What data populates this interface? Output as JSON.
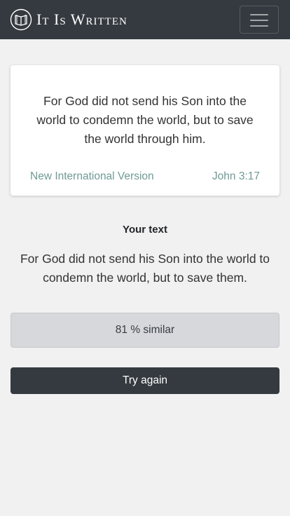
{
  "navbar": {
    "brand_title": "It Is Written",
    "logo_icon": "open-book-icon",
    "menu_icon": "hamburger-menu-icon"
  },
  "verse": {
    "text": "For God did not send his Son into the world to condemn the world, but to save the world through him.",
    "version": "New International Version",
    "reference": "John 3:17"
  },
  "user_entry": {
    "label": "Your text",
    "text": "For God did not send his Son into the world to condemn the world, but to save them."
  },
  "result": {
    "similarity_text": "81 % similar"
  },
  "actions": {
    "try_again_label": "Try again"
  },
  "colors": {
    "navbar_bg": "#343a40",
    "page_bg": "#f1f1f1",
    "muted_teal": "#6f9a96",
    "similarity_bg": "#d6d8db"
  }
}
